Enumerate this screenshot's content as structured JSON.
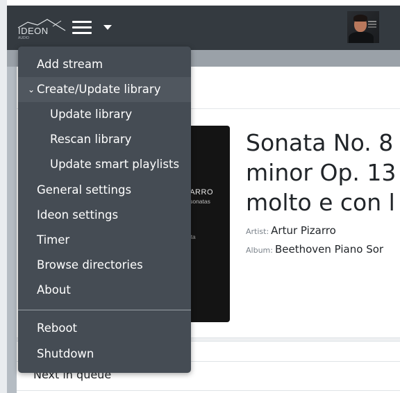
{
  "navbar": {
    "logo_text": "IDEON",
    "logo_subtext": "AUDIO"
  },
  "menu": {
    "items": [
      {
        "label": "Add stream"
      },
      {
        "label": "Create/Update library",
        "expanded": true
      },
      {
        "label": "Update library"
      },
      {
        "label": "Rescan library"
      },
      {
        "label": "Update smart playlists"
      },
      {
        "label": "General settings"
      },
      {
        "label": "Ideon settings"
      },
      {
        "label": "Timer"
      },
      {
        "label": "Browse directories"
      },
      {
        "label": "About"
      },
      {
        "label": "Reboot"
      },
      {
        "label": "Shutdown"
      }
    ],
    "chevron": "⌄"
  },
  "album_art": {
    "line1": "ZARRO",
    "line2": "o sonatas",
    "line3": "e",
    "line4": "t",
    "line5": "nata"
  },
  "now_playing": {
    "title_lines": [
      "Sonata No. 8",
      "minor Op. 13",
      "molto e con l"
    ],
    "artist_key": "Artist:",
    "artist": "Artur Pizarro",
    "album_key": "Album:",
    "album": "Beethoven Piano Sor"
  },
  "queue": {
    "header": "Next in queue"
  },
  "colors": {
    "navbar": "#343a40",
    "menu_bg": "#454c54",
    "menu_active": "#50575f"
  }
}
